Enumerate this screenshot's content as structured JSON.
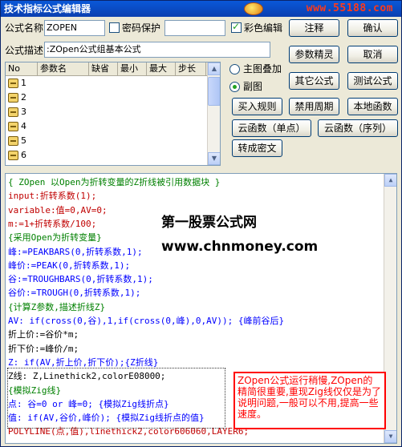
{
  "window": {
    "title": "技术指标公式编辑器",
    "watermark": "www.55188.com"
  },
  "form": {
    "name_label": "公式名称",
    "name_value": "ZOPEN",
    "password_label": "密码保护",
    "password_checked": false,
    "color_label": "彩色编辑",
    "color_checked": true,
    "desc_label": "公式描述",
    "desc_value": ":ZOpen公式组基本公式"
  },
  "buttons": {
    "note": "注释",
    "ok": "确认",
    "param_tune": "参数精灵",
    "cancel": "取消",
    "other_formula": "其它公式",
    "test_formula": "测试公式",
    "buy_rule": "买入规则",
    "disable_period": "禁用周期",
    "local_func": "本地函数",
    "cloud_single": "云函数（单点）",
    "cloud_seq": "云函数（序列）",
    "to_cipher": "转成密文"
  },
  "radios": {
    "main_overlay": "主图叠加",
    "sub_chart": "副图",
    "selected": "副图"
  },
  "param_table": {
    "headers": [
      "No",
      "参数名",
      "缺省",
      "最小",
      "最大",
      "步长"
    ],
    "rows": [
      "1",
      "2",
      "3",
      "4",
      "5",
      "6"
    ]
  },
  "editor": {
    "lines": [
      {
        "text": "{ ZOpen 以Open为折转变量的Z折线被引用数据块 }",
        "color": "green"
      },
      {
        "text": "input:折转系数(1);",
        "color": "red"
      },
      {
        "text": "variable:值=0,AV=0;",
        "color": "red"
      },
      {
        "text": "m:=1+折转系数/100;",
        "color": "red"
      },
      {
        "text": "{采用Open为折转变量}",
        "color": "green"
      },
      {
        "text": "峰:=PEAKBARS(0,折转系数,1);",
        "color": "blue"
      },
      {
        "text": "峰价:=PEAK(0,折转系数,1);",
        "color": "blue"
      },
      {
        "text": "谷:=TROUGHBARS(0,折转系数,1);",
        "color": "blue"
      },
      {
        "text": "谷价:=TROUGH(0,折转系数,1);",
        "color": "blue"
      },
      {
        "text": "{计算Z参数,描述折线Z}",
        "color": "green"
      },
      {
        "text": "AV: if(cross(0,谷),1,if(cross(0,峰),0,AV)); {峰前谷后}",
        "color": "blue"
      },
      {
        "text": "折上价:=谷价*m;",
        "color": "black"
      },
      {
        "text": "折下价:=峰价/m;",
        "color": "black"
      },
      {
        "text": "Z: if(AV,折上价,折下价);{Z折线}",
        "color": "blue"
      },
      {
        "text": "Z线: Z,Linethick2,colorE08000;",
        "color": "black"
      },
      {
        "text": "{模拟Zig线}",
        "color": "green"
      },
      {
        "text": "点: 谷=0 or 峰=0; {模拟Zig线折点}",
        "color": "blue"
      },
      {
        "text": "值: if(AV,谷价,峰价); {模拟Zig线折点的值}",
        "color": "blue"
      },
      {
        "text": "POLYLINE(点,值),linethick2,color606060,LAYER6;",
        "color": "red"
      }
    ]
  },
  "overlays": {
    "site_name": "第一股票公式网",
    "site_url": "www.chnmoney.com",
    "note_text": "ZOpen公式运行稍慢,ZOpen的精简很重要,重现Zig线仅仅是为了说明问题,一般可以不用,提高一些速度。"
  }
}
